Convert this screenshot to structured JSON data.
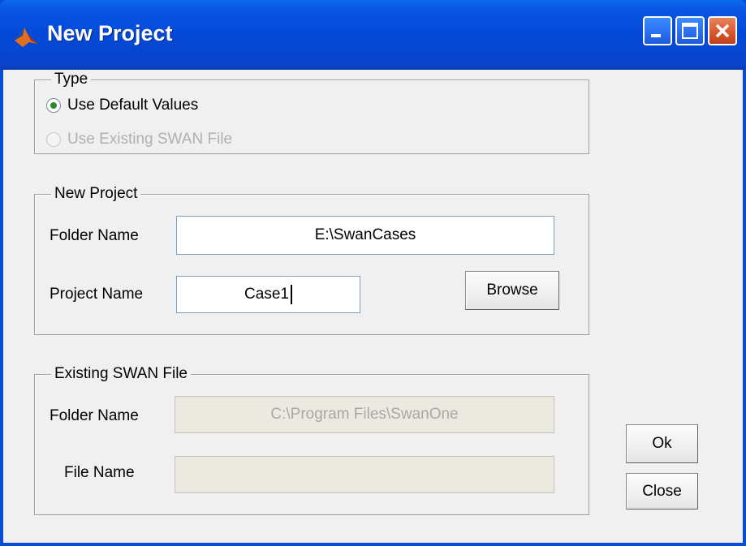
{
  "window": {
    "title": "New Project",
    "controls": [
      "minimize-icon",
      "maximize-icon",
      "close-icon"
    ]
  },
  "type_group": {
    "legend": "Type",
    "options": [
      {
        "label": "Use Default Values",
        "selected": true,
        "enabled": true
      },
      {
        "label": "Use Existing SWAN File",
        "selected": false,
        "enabled": false
      }
    ]
  },
  "new_project": {
    "legend": "New Project",
    "folder_label": "Folder Name",
    "folder_value": "E:\\SwanCases",
    "project_label": "Project Name",
    "project_value": "Case1",
    "browse_label": "Browse"
  },
  "existing_file": {
    "legend": "Existing SWAN File",
    "folder_label": "Folder Name",
    "folder_value": "C:\\Program Files\\SwanOne",
    "file_label": "File Name",
    "file_value": ""
  },
  "actions": {
    "ok_label": "Ok",
    "close_label": "Close"
  },
  "colors": {
    "titlebar": "#0349d8",
    "client": "#f0f0f0",
    "disabled_field": "#ebe9e0",
    "radio_selected": "#2a8a2a"
  }
}
